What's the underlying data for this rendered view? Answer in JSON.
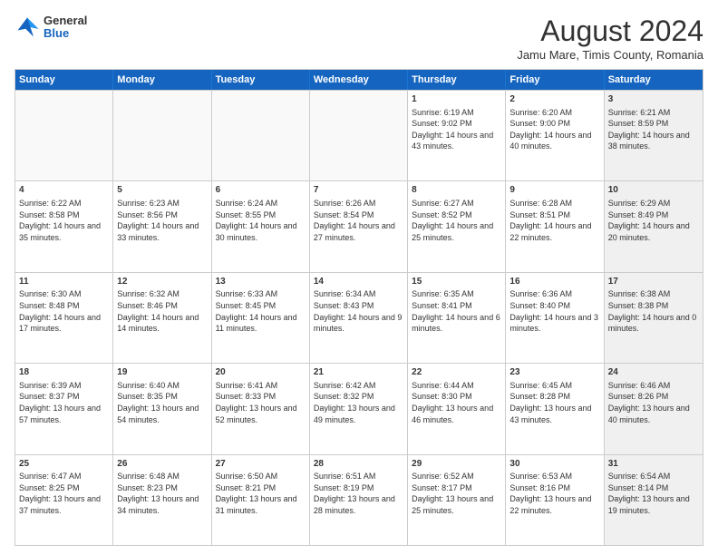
{
  "header": {
    "logo": {
      "general": "General",
      "blue": "Blue"
    },
    "title": "August 2024",
    "location": "Jamu Mare, Timis County, Romania"
  },
  "calendar": {
    "days": [
      "Sunday",
      "Monday",
      "Tuesday",
      "Wednesday",
      "Thursday",
      "Friday",
      "Saturday"
    ],
    "rows": [
      [
        {
          "day": "",
          "empty": true
        },
        {
          "day": "",
          "empty": true
        },
        {
          "day": "",
          "empty": true
        },
        {
          "day": "",
          "empty": true
        },
        {
          "day": "1",
          "rise": "6:19 AM",
          "set": "9:02 PM",
          "daylight": "14 hours and 43 minutes."
        },
        {
          "day": "2",
          "rise": "6:20 AM",
          "set": "9:00 PM",
          "daylight": "14 hours and 40 minutes."
        },
        {
          "day": "3",
          "rise": "6:21 AM",
          "set": "8:59 PM",
          "daylight": "14 hours and 38 minutes.",
          "shaded": true
        }
      ],
      [
        {
          "day": "4",
          "rise": "6:22 AM",
          "set": "8:58 PM",
          "daylight": "14 hours and 35 minutes."
        },
        {
          "day": "5",
          "rise": "6:23 AM",
          "set": "8:56 PM",
          "daylight": "14 hours and 33 minutes."
        },
        {
          "day": "6",
          "rise": "6:24 AM",
          "set": "8:55 PM",
          "daylight": "14 hours and 30 minutes."
        },
        {
          "day": "7",
          "rise": "6:26 AM",
          "set": "8:54 PM",
          "daylight": "14 hours and 27 minutes."
        },
        {
          "day": "8",
          "rise": "6:27 AM",
          "set": "8:52 PM",
          "daylight": "14 hours and 25 minutes."
        },
        {
          "day": "9",
          "rise": "6:28 AM",
          "set": "8:51 PM",
          "daylight": "14 hours and 22 minutes."
        },
        {
          "day": "10",
          "rise": "6:29 AM",
          "set": "8:49 PM",
          "daylight": "14 hours and 20 minutes.",
          "shaded": true
        }
      ],
      [
        {
          "day": "11",
          "rise": "6:30 AM",
          "set": "8:48 PM",
          "daylight": "14 hours and 17 minutes."
        },
        {
          "day": "12",
          "rise": "6:32 AM",
          "set": "8:46 PM",
          "daylight": "14 hours and 14 minutes."
        },
        {
          "day": "13",
          "rise": "6:33 AM",
          "set": "8:45 PM",
          "daylight": "14 hours and 11 minutes."
        },
        {
          "day": "14",
          "rise": "6:34 AM",
          "set": "8:43 PM",
          "daylight": "14 hours and 9 minutes."
        },
        {
          "day": "15",
          "rise": "6:35 AM",
          "set": "8:41 PM",
          "daylight": "14 hours and 6 minutes."
        },
        {
          "day": "16",
          "rise": "6:36 AM",
          "set": "8:40 PM",
          "daylight": "14 hours and 3 minutes."
        },
        {
          "day": "17",
          "rise": "6:38 AM",
          "set": "8:38 PM",
          "daylight": "14 hours and 0 minutes.",
          "shaded": true
        }
      ],
      [
        {
          "day": "18",
          "rise": "6:39 AM",
          "set": "8:37 PM",
          "daylight": "13 hours and 57 minutes."
        },
        {
          "day": "19",
          "rise": "6:40 AM",
          "set": "8:35 PM",
          "daylight": "13 hours and 54 minutes."
        },
        {
          "day": "20",
          "rise": "6:41 AM",
          "set": "8:33 PM",
          "daylight": "13 hours and 52 minutes."
        },
        {
          "day": "21",
          "rise": "6:42 AM",
          "set": "8:32 PM",
          "daylight": "13 hours and 49 minutes."
        },
        {
          "day": "22",
          "rise": "6:44 AM",
          "set": "8:30 PM",
          "daylight": "13 hours and 46 minutes."
        },
        {
          "day": "23",
          "rise": "6:45 AM",
          "set": "8:28 PM",
          "daylight": "13 hours and 43 minutes."
        },
        {
          "day": "24",
          "rise": "6:46 AM",
          "set": "8:26 PM",
          "daylight": "13 hours and 40 minutes.",
          "shaded": true
        }
      ],
      [
        {
          "day": "25",
          "rise": "6:47 AM",
          "set": "8:25 PM",
          "daylight": "13 hours and 37 minutes."
        },
        {
          "day": "26",
          "rise": "6:48 AM",
          "set": "8:23 PM",
          "daylight": "13 hours and 34 minutes."
        },
        {
          "day": "27",
          "rise": "6:50 AM",
          "set": "8:21 PM",
          "daylight": "13 hours and 31 minutes."
        },
        {
          "day": "28",
          "rise": "6:51 AM",
          "set": "8:19 PM",
          "daylight": "13 hours and 28 minutes."
        },
        {
          "day": "29",
          "rise": "6:52 AM",
          "set": "8:17 PM",
          "daylight": "13 hours and 25 minutes."
        },
        {
          "day": "30",
          "rise": "6:53 AM",
          "set": "8:16 PM",
          "daylight": "13 hours and 22 minutes."
        },
        {
          "day": "31",
          "rise": "6:54 AM",
          "set": "8:14 PM",
          "daylight": "13 hours and 19 minutes.",
          "shaded": true
        }
      ]
    ]
  }
}
